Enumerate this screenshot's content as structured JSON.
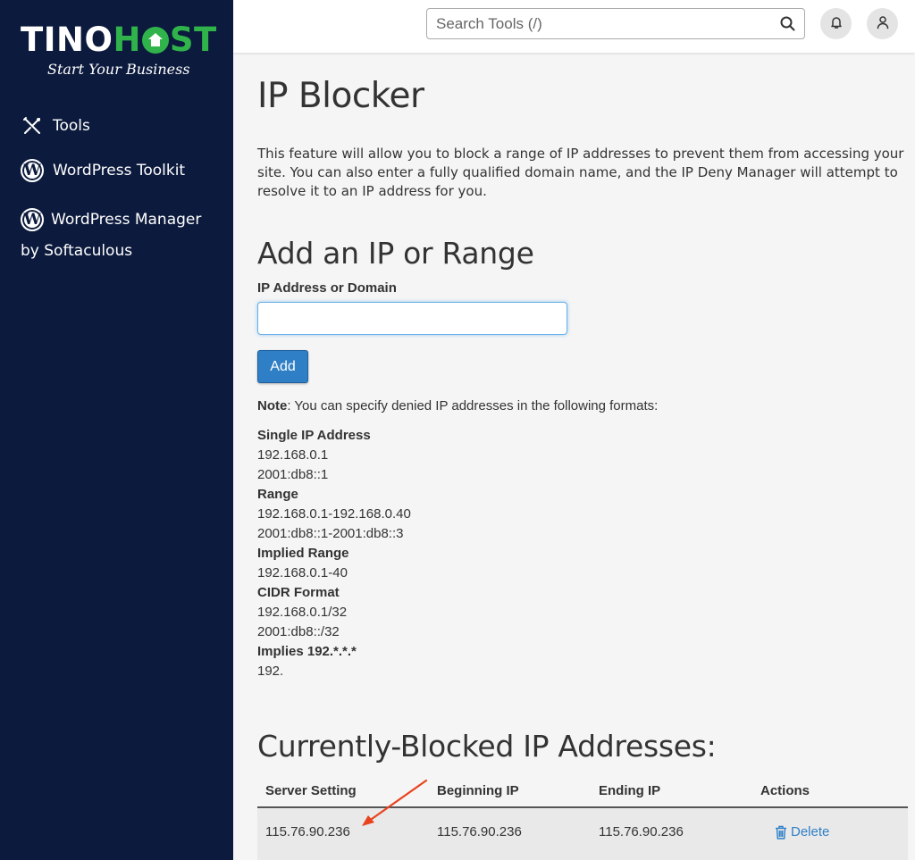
{
  "brand": {
    "name_part1": "TINO",
    "name_part2_a": "H",
    "name_part2_b": "ST",
    "tagline": "Start Your Business",
    "accent_color": "#2fb34a",
    "sidebar_bg": "#0c1a3d"
  },
  "sidebar": {
    "items": [
      {
        "label": "Tools",
        "icon": "tools-icon"
      },
      {
        "label": "WordPress Toolkit",
        "icon": "wordpress-icon"
      },
      {
        "label": "WordPress Manager by Softaculous",
        "icon": "wordpress-icon"
      }
    ]
  },
  "topbar": {
    "search_placeholder": "Search Tools (/)",
    "icons": [
      "search-icon",
      "bell-icon",
      "user-icon"
    ]
  },
  "page": {
    "title": "IP Blocker",
    "intro": "This feature will allow you to block a range of IP addresses to prevent them from accessing your site. You can also enter a fully qualified domain name, and the IP Deny Manager will attempt to resolve it to an IP address for you.",
    "add_section_title": "Add an IP or Range",
    "field_label": "IP Address or Domain",
    "field_value": "",
    "add_button": "Add",
    "note_label": "Note",
    "note_text": ": You can specify denied IP addresses in the following formats:",
    "formats": [
      {
        "heading": "Single IP Address",
        "examples": [
          "192.168.0.1",
          "2001:db8::1"
        ]
      },
      {
        "heading": "Range",
        "examples": [
          "192.168.0.1-192.168.0.40",
          "2001:db8::1-2001:db8::3"
        ]
      },
      {
        "heading": "Implied Range",
        "examples": [
          "192.168.0.1-40"
        ]
      },
      {
        "heading": "CIDR Format",
        "examples": [
          "192.168.0.1/32",
          "2001:db8::/32"
        ]
      },
      {
        "heading": "Implies 192.*.*.*",
        "examples": [
          "192."
        ]
      }
    ],
    "blocked_section_title": "Currently-Blocked IP Addresses:",
    "table": {
      "headers": [
        "Server Setting",
        "Beginning IP",
        "Ending IP",
        "Actions"
      ],
      "rows": [
        {
          "server_setting": "115.76.90.236",
          "beginning_ip": "115.76.90.236",
          "ending_ip": "115.76.90.236",
          "action": "Delete"
        }
      ]
    },
    "link_color": "#2f7fc7",
    "annotation_color": "#e8431e"
  }
}
